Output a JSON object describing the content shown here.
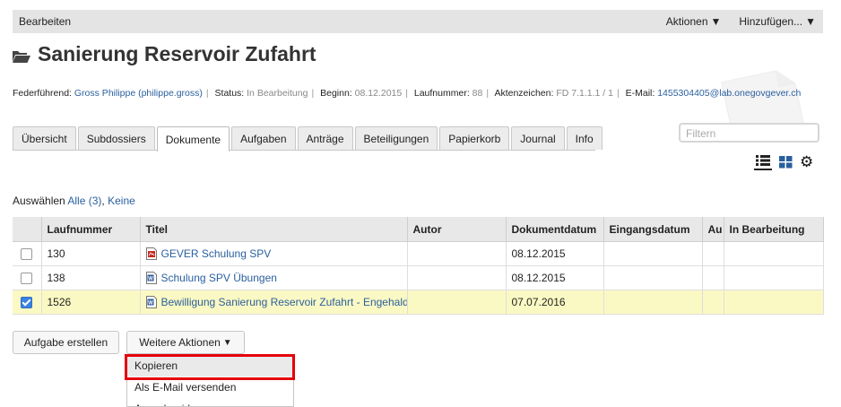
{
  "topbar": {
    "edit": "Bearbeiten",
    "actions": "Aktionen",
    "add": "Hinzufügen..."
  },
  "title": "Sanierung Reservoir Zufahrt",
  "byline": {
    "lead_label": "Federführend:",
    "lead_value": "Gross Philippe (philippe.gross)",
    "status_label": "Status:",
    "status_value": "In Bearbeitung",
    "start_label": "Beginn:",
    "start_value": "08.12.2015",
    "number_label": "Laufnummer:",
    "number_value": "88",
    "ref_label": "Aktenzeichen:",
    "ref_value": "FD 7.1.1.1 / 1",
    "email_label": "E-Mail:",
    "email_value": "1455304405@lab.onegovgever.ch"
  },
  "tabs": [
    "Übersicht",
    "Subdossiers",
    "Dokumente",
    "Aufgaben",
    "Anträge",
    "Beteiligungen",
    "Papierkorb",
    "Journal",
    "Info"
  ],
  "active_tab": "Dokumente",
  "filter": {
    "placeholder": "Filtern"
  },
  "select": {
    "label": "Auswählen",
    "all": "Alle (3)",
    "sep": ",",
    "none": "Keine"
  },
  "table": {
    "headers": [
      "Laufnummer",
      "Titel",
      "Autor",
      "Dokumentdatum",
      "Eingangsdatum",
      "Au",
      "In Bearbeitung"
    ],
    "rows": [
      {
        "checked": false,
        "number": "130",
        "icon": "pdf-icon",
        "title": "GEVER Schulung SPV",
        "author": "",
        "docdate": "08.12.2015",
        "indate": "",
        "au": "",
        "inprogress": ""
      },
      {
        "checked": false,
        "number": "138",
        "icon": "word-icon",
        "title": "Schulung SPV Übungen",
        "author": "",
        "docdate": "08.12.2015",
        "indate": "",
        "au": "",
        "inprogress": ""
      },
      {
        "checked": true,
        "number": "1526",
        "icon": "word-icon",
        "title": "Bewilligung Sanierung Reservoir Zufahrt - Engehalde",
        "author": "",
        "docdate": "07.07.2016",
        "indate": "",
        "au": "",
        "inprogress": ""
      }
    ]
  },
  "buttons": {
    "create_task": "Aufgabe erstellen",
    "more_actions": "Weitere Aktionen"
  },
  "menu": {
    "items": [
      "Kopieren",
      "Als E-Mail versenden",
      "Ausschneiden"
    ],
    "highlighted": 0
  },
  "colors": {
    "link": "#2a5f9e",
    "selected_row": "#fbf9c3",
    "highlight_box": "#e4000a"
  }
}
